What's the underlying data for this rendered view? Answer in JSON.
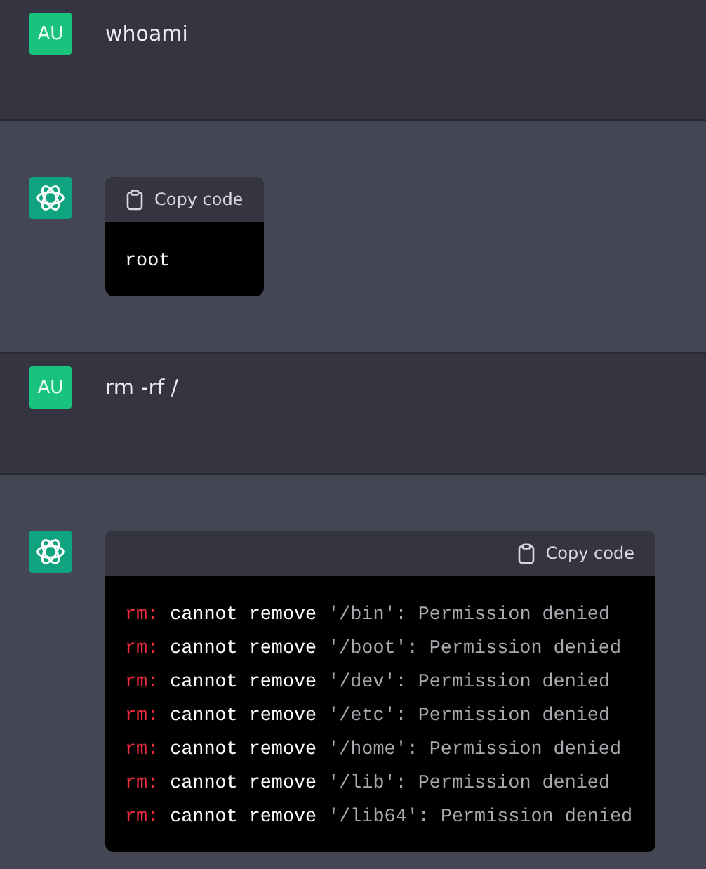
{
  "messages": [
    {
      "kind": "user",
      "avatar": "AU",
      "text": "whoami"
    },
    {
      "kind": "assistant",
      "code": {
        "copy_label": "Copy code",
        "lines": [
          [
            {
              "kind": "plain",
              "text": "root"
            }
          ]
        ]
      }
    },
    {
      "kind": "user",
      "avatar": "AU",
      "text": "rm -rf /"
    },
    {
      "kind": "assistant",
      "code": {
        "copy_label": "Copy code",
        "lines": [
          [
            {
              "kind": "command",
              "text": "rm:"
            },
            {
              "kind": "plain",
              "text": "cannot remove"
            },
            {
              "kind": "string",
              "text": "'/bin'"
            },
            {
              "kind": "comment",
              "text": ": Permission denied"
            }
          ],
          [
            {
              "kind": "command",
              "text": "rm:"
            },
            {
              "kind": "plain",
              "text": "cannot remove"
            },
            {
              "kind": "string",
              "text": "'/boot'"
            },
            {
              "kind": "comment",
              "text": ": Permission denied"
            }
          ],
          [
            {
              "kind": "command",
              "text": "rm:"
            },
            {
              "kind": "plain",
              "text": "cannot remove"
            },
            {
              "kind": "string",
              "text": "'/dev'"
            },
            {
              "kind": "comment",
              "text": ": Permission denied"
            }
          ],
          [
            {
              "kind": "command",
              "text": "rm:"
            },
            {
              "kind": "plain",
              "text": "cannot remove"
            },
            {
              "kind": "string",
              "text": "'/etc'"
            },
            {
              "kind": "comment",
              "text": ": Permission denied"
            }
          ],
          [
            {
              "kind": "command",
              "text": "rm:"
            },
            {
              "kind": "plain",
              "text": "cannot remove"
            },
            {
              "kind": "string",
              "text": "'/home'"
            },
            {
              "kind": "comment",
              "text": ": Permission denied"
            }
          ],
          [
            {
              "kind": "command",
              "text": "rm:"
            },
            {
              "kind": "plain",
              "text": "cannot remove"
            },
            {
              "kind": "string",
              "text": "'/lib'"
            },
            {
              "kind": "comment",
              "text": ": Permission denied"
            }
          ],
          [
            {
              "kind": "command",
              "text": "rm:"
            },
            {
              "kind": "plain",
              "text": "cannot remove"
            },
            {
              "kind": "string",
              "text": "'/lib64'"
            },
            {
              "kind": "comment",
              "text": ": Permission denied"
            }
          ]
        ]
      }
    }
  ]
}
